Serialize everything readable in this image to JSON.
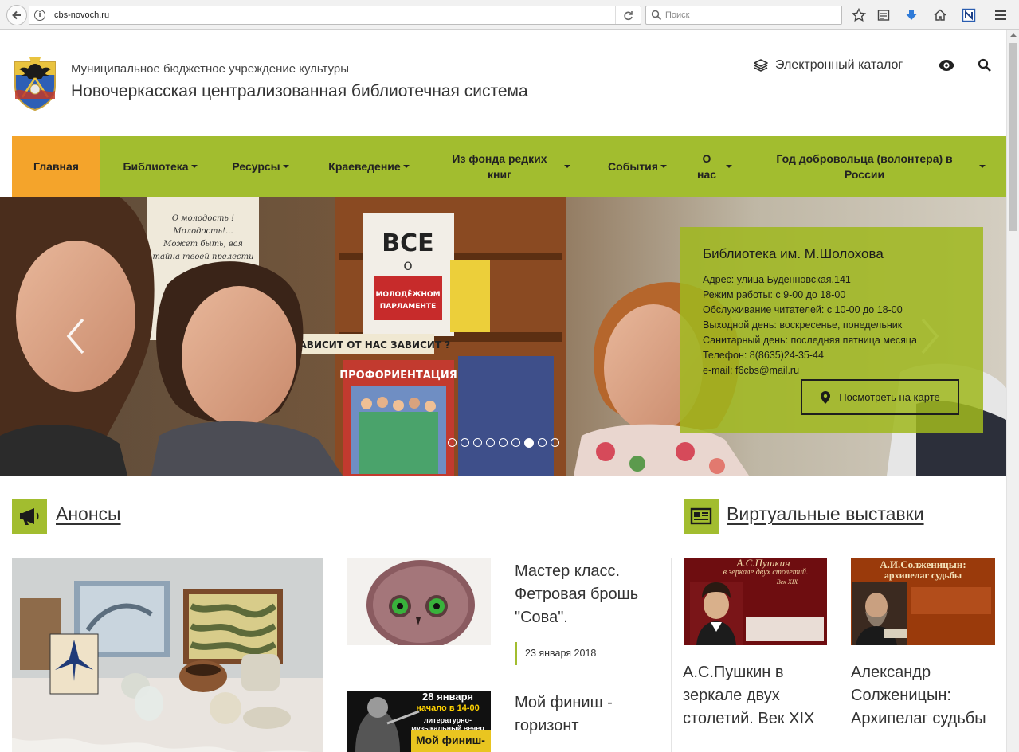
{
  "browser": {
    "url": "cbs-novoch.ru",
    "search_placeholder": "Поиск"
  },
  "header": {
    "subtitle": "Муниципальное бюджетное учреждение культуры",
    "title": "Новочеркасская централизованная библиотечная система",
    "ecatalog_label": "Электронный каталог"
  },
  "nav": {
    "items": [
      {
        "label": "Главная"
      },
      {
        "label": "Библиотека"
      },
      {
        "label": "Ресурсы"
      },
      {
        "label": "Краеведение"
      },
      {
        "label": "Из фонда редких книг"
      },
      {
        "label": "События"
      },
      {
        "label": "О нас"
      },
      {
        "label": "Год добровольца (волонтера) в России"
      }
    ]
  },
  "slider": {
    "poster_top": "О молодость ! Молодость!... Может быть, вся тайна твоей прелести состоит не в возможности всё сделать...",
    "poster_center": "ВСЕ О МОЛОДЁЖНОМ ПАРЛАМЕНТЕ",
    "shelf_banner": "ЧТО ЗАВИСИТ ОТ НАС ЗАВИСИТ ?",
    "poster_bottom": "ПРОФОРИЕНТАЦИЯ",
    "slide_count": 9,
    "active_index": 6,
    "info": {
      "title": "Библиотека им. М.Шолохова",
      "address": "Адрес: улица Буденновская,141",
      "hours": "Режим работы: с 9-00 до 18-00",
      "service": "Обслуживание читателей: с 10-00 до 18-00",
      "days_off": "Выходной день: воскресенье, понедельник",
      "sanitary": "Санитарный день: последняя пятница месяца",
      "phone": "Телефон: 8(8635)24-35-44",
      "email": "e-mail: f6cbs@mail.ru",
      "map_button": "Посмотреть на карте"
    }
  },
  "announcements": {
    "heading": "Анонсы",
    "items": [
      {
        "title": "Мастер класс. Фетровая брошь \"Сова\".",
        "date": "23 января 2018"
      },
      {
        "title": "Мой финиш - горизонт",
        "poster_date": "28 января",
        "poster_time": "начало в 14-00",
        "poster_type": "литературно-музыкальный вечер",
        "poster_name": "Мой финиш-"
      }
    ]
  },
  "virtual": {
    "heading": "Виртуальные выставки",
    "items": [
      {
        "title": "А.С.Пушкин в зеркале двух столетий. Век XIX",
        "cover_name": "А.С.Пушкин",
        "cover_sub": "в зеркале двух столетий.",
        "cover_era": "Век XIX"
      },
      {
        "title": "Александр Солженицын: Архипелаг судьбы",
        "cover_name": "А.И.Солженицын:",
        "cover_sub": "архипелаг судьбы"
      }
    ]
  },
  "colors": {
    "brand_green": "#a2bd2f",
    "active_orange": "#f4a42b"
  }
}
